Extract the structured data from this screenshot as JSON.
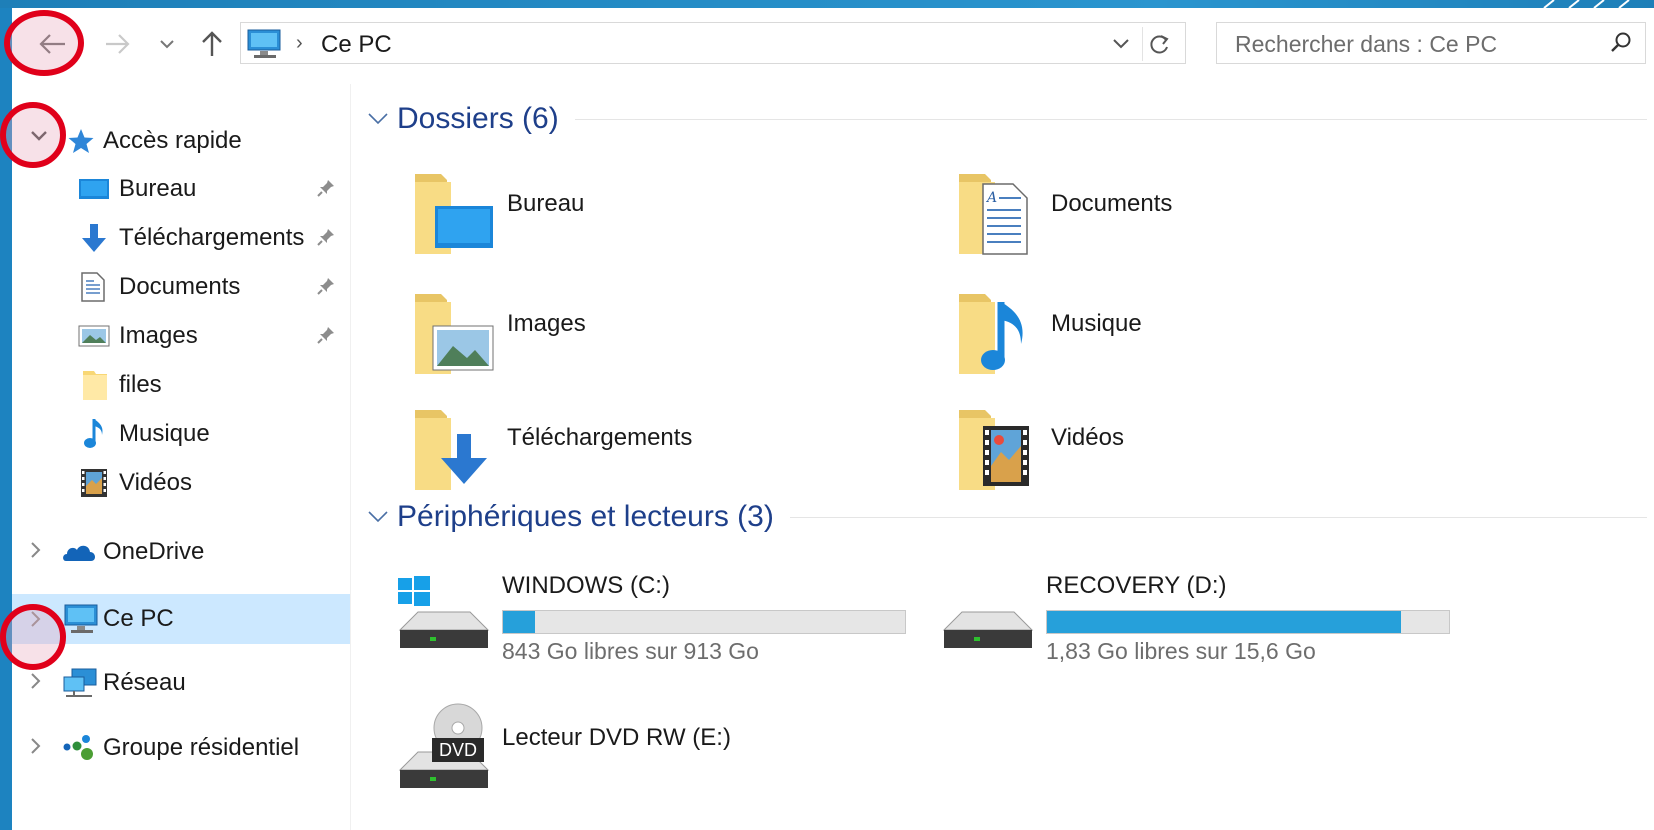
{
  "address_bar": {
    "path": "Ce PC",
    "separator": "›"
  },
  "search": {
    "placeholder": "Rechercher dans : Ce PC"
  },
  "sidebar": {
    "quick_access": {
      "label": "Accès rapide",
      "icon": "star-icon"
    },
    "quick_items": [
      {
        "label": "Bureau",
        "icon": "desktop-icon",
        "pinned": true
      },
      {
        "label": "Téléchargements",
        "icon": "download-arrow-icon",
        "pinned": true
      },
      {
        "label": "Documents",
        "icon": "document-icon",
        "pinned": true
      },
      {
        "label": "Images",
        "icon": "image-icon",
        "pinned": true
      },
      {
        "label": "files",
        "icon": "folder-icon",
        "pinned": false
      },
      {
        "label": "Musique",
        "icon": "music-note-icon",
        "pinned": false
      },
      {
        "label": "Vidéos",
        "icon": "film-icon",
        "pinned": false
      }
    ],
    "roots": [
      {
        "label": "OneDrive",
        "icon": "cloud-icon",
        "selected": false
      },
      {
        "label": "Ce PC",
        "icon": "computer-icon",
        "selected": true
      },
      {
        "label": "Réseau",
        "icon": "network-icon",
        "selected": false
      },
      {
        "label": "Groupe résidentiel",
        "icon": "homegroup-icon",
        "selected": false
      }
    ]
  },
  "main": {
    "folders_header": "Dossiers (6)",
    "folders": [
      {
        "label": "Bureau",
        "icon": "desktop-folder-icon"
      },
      {
        "label": "Documents",
        "icon": "documents-folder-icon"
      },
      {
        "label": "Images",
        "icon": "images-folder-icon"
      },
      {
        "label": "Musique",
        "icon": "music-folder-icon"
      },
      {
        "label": "Téléchargements",
        "icon": "downloads-folder-icon"
      },
      {
        "label": "Vidéos",
        "icon": "videos-folder-icon"
      }
    ],
    "devices_header": "Périphériques et lecteurs (3)",
    "drives": [
      {
        "label": "WINDOWS (C:)",
        "free_text": "843 Go libres sur 913 Go",
        "used_fraction": 0.08,
        "icon": "windows-drive-icon"
      },
      {
        "label": "RECOVERY (D:)",
        "free_text": "1,83 Go libres sur 15,6 Go",
        "used_fraction": 0.88,
        "icon": "drive-icon"
      }
    ],
    "dvd": {
      "label": "Lecteur DVD RW (E:)",
      "badge": "DVD",
      "icon": "dvd-drive-icon"
    }
  },
  "colors": {
    "accent": "#26a0da",
    "header_text": "#1e3f8a",
    "selection": "#cce8ff",
    "highlight_ring": "#e0001a"
  }
}
